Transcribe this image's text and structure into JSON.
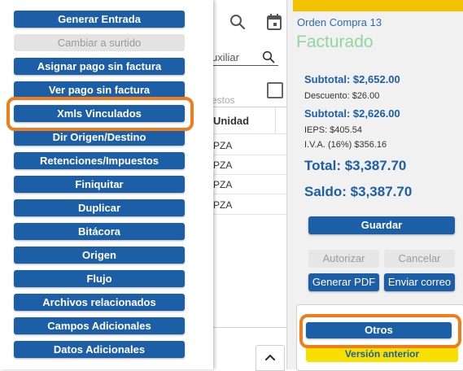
{
  "menu": {
    "items": [
      {
        "label": "Generar Entrada",
        "disabled": false
      },
      {
        "label": "Cambiar a surtido",
        "disabled": true
      },
      {
        "label": "Asignar pago sin factura",
        "disabled": false
      },
      {
        "label": "Ver pago sin factura",
        "disabled": false
      },
      {
        "label": "Xmls Vinculados",
        "disabled": false
      },
      {
        "label": "Dir Origen/Destino",
        "disabled": false
      },
      {
        "label": "Retenciones/Impuestos",
        "disabled": false
      },
      {
        "label": "Finiquitar",
        "disabled": false
      },
      {
        "label": "Duplicar",
        "disabled": false
      },
      {
        "label": "Bitácora",
        "disabled": false
      },
      {
        "label": "Origen",
        "disabled": false
      },
      {
        "label": "Flujo",
        "disabled": false
      },
      {
        "label": "Archivos relacionados",
        "disabled": false
      },
      {
        "label": "Campos Adicionales",
        "disabled": false
      },
      {
        "label": "Datos Adicionales",
        "disabled": false
      }
    ]
  },
  "middle": {
    "search_field_text": "uxiliar",
    "column_hint": "estos",
    "column_header": "Unidad",
    "rows": [
      "PZA",
      "PZA",
      "PZA",
      "PZA"
    ]
  },
  "order": {
    "title": "Orden Compra 13",
    "status": "Facturado",
    "subtotal1": "Subtotal: $2,652.00",
    "descuento": "Descuento: $26.00",
    "subtotal2": "Subtotal: $2,626.00",
    "ieps": "IEPS: $405.54",
    "iva": "I.V.A. (16%) $356.16",
    "total": "Total: $3,387.70",
    "saldo": "Saldo: $3,387.70"
  },
  "actions": {
    "guardar": "Guardar",
    "autorizar": "Autorizar",
    "cancelar": "Cancelar",
    "generar_pdf": "Generar PDF",
    "enviar_correo": "Enviar correo",
    "otros": "Otros",
    "version_anterior": "Versión anterior"
  },
  "colors": {
    "primary": "#1d5fa6",
    "highlight": "#f07d1c",
    "status_green": "#8fd6a0",
    "warning_yellow": "#f2d300"
  }
}
